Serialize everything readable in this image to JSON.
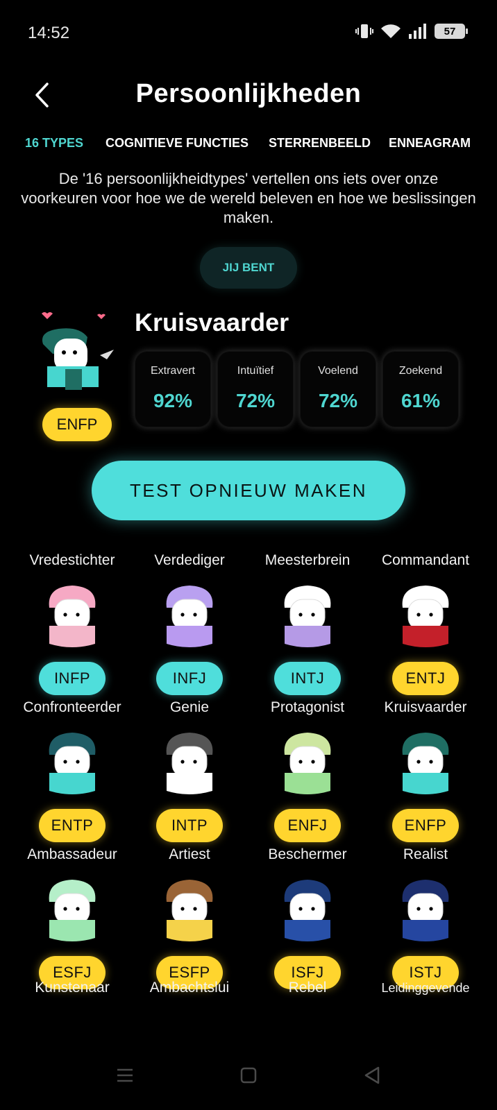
{
  "status": {
    "time": "14:52",
    "battery": "57"
  },
  "header": {
    "title": "Persoonlijkheden"
  },
  "tabs": [
    {
      "label": "16 TYPES",
      "active": true
    },
    {
      "label": "COGNITIEVE FUNCTIES",
      "active": false
    },
    {
      "label": "STERRENBEELD",
      "active": false
    },
    {
      "label": "ENNEAGRAM",
      "active": false
    }
  ],
  "intro": "De '16 persoonlijkheidtypes' vertellen ons iets over onze voorkeuren voor hoe we de wereld beleven en hoe we beslissingen maken.",
  "you_are": "JIJ BENT",
  "result": {
    "name": "Kruisvaarder",
    "code": "ENFP",
    "traits": [
      {
        "label": "Extravert",
        "value": "92%"
      },
      {
        "label": "Intuïtief",
        "value": "72%"
      },
      {
        "label": "Voelend",
        "value": "72%"
      },
      {
        "label": "Zoekend",
        "value": "61%"
      }
    ]
  },
  "retake_label": "TEST OPNIEUW MAKEN",
  "types": [
    {
      "name": "Vredestichter",
      "code": "INFP",
      "badge": "teal",
      "hair": "#f6a9c4",
      "body": "#f3b6c9"
    },
    {
      "name": "Verdediger",
      "code": "INFJ",
      "badge": "teal",
      "hair": "#b9a0f0",
      "body": "#b99af0"
    },
    {
      "name": "Meesterbrein",
      "code": "INTJ",
      "badge": "teal",
      "hair": "#ffffff",
      "body": "#b59ae6"
    },
    {
      "name": "Commandant",
      "code": "ENTJ",
      "badge": "yellow",
      "hair": "#ffffff",
      "body": "#c4202a"
    },
    {
      "name": "Confronteerder",
      "code": "ENTP",
      "badge": "yellow",
      "hair": "#1f5d66",
      "body": "#47d6cf"
    },
    {
      "name": "Genie",
      "code": "INTP",
      "badge": "yellow",
      "hair": "#555555",
      "body": "#ffffff"
    },
    {
      "name": "Protagonist",
      "code": "ENFJ",
      "badge": "yellow",
      "hair": "#cde6a0",
      "body": "#9be095"
    },
    {
      "name": "Kruisvaarder",
      "code": "ENFP",
      "badge": "yellow",
      "hair": "#1f6e63",
      "body": "#47d6cf"
    },
    {
      "name": "Ambassadeur",
      "code": "ESFJ",
      "badge": "yellow",
      "hair": "#b5efc9",
      "body": "#9be6b0"
    },
    {
      "name": "Artiest",
      "code": "ESFP",
      "badge": "yellow",
      "hair": "#9a6436",
      "body": "#f5d24a"
    },
    {
      "name": "Beschermer",
      "code": "ISFJ",
      "badge": "yellow",
      "hair": "#1d3b7a",
      "body": "#2850a8"
    },
    {
      "name": "Realist",
      "code": "ISTJ",
      "badge": "yellow",
      "hair": "#1d2f6e",
      "body": "#2546a0"
    }
  ],
  "bottom_names": [
    "Kunstenaar",
    "Ambachtslui",
    "Rebel",
    "Leidinggevende"
  ],
  "colors": {
    "accent_teal": "#4fdedb",
    "accent_yellow": "#ffd52e",
    "background": "#000000"
  },
  "icons": {
    "status": [
      "vibrate-icon",
      "wifi-icon",
      "signal-icon",
      "battery-icon"
    ],
    "header": "back-chevron-icon",
    "nav": [
      "menu-icon",
      "home-square-icon",
      "back-triangle-icon"
    ]
  }
}
